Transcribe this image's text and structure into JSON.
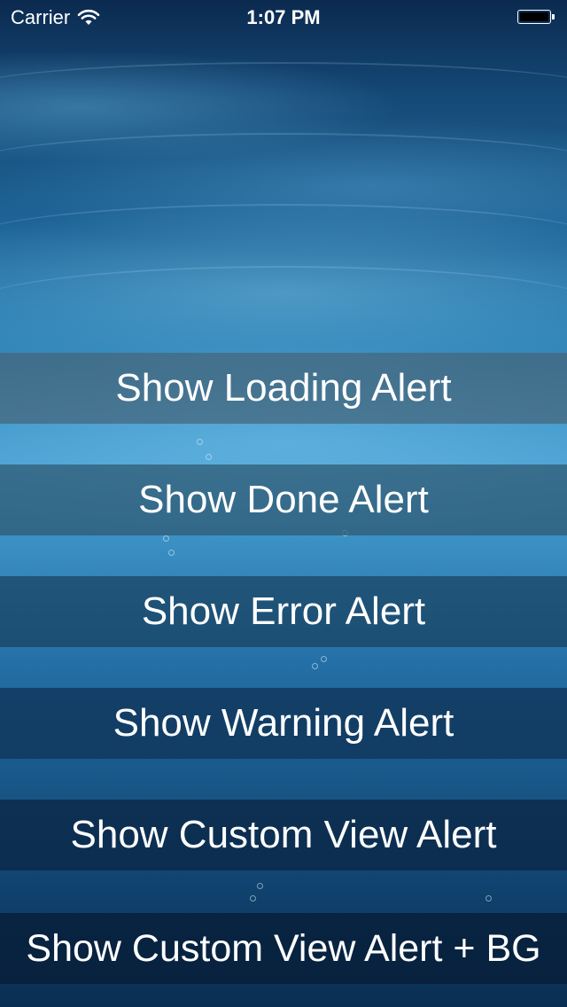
{
  "status_bar": {
    "carrier": "Carrier",
    "time": "1:07 PM",
    "wifi_icon": "wifi-icon",
    "battery_icon": "battery-icon"
  },
  "background": {
    "description_colors": {
      "deep": "#0b2a4f",
      "mid": "#2a7eb2",
      "light": "#4a9fd0"
    }
  },
  "buttons": [
    {
      "label": "Show Loading Alert"
    },
    {
      "label": "Show Done Alert"
    },
    {
      "label": "Show Error Alert"
    },
    {
      "label": "Show Warning Alert"
    },
    {
      "label": "Show Custom View Alert"
    },
    {
      "label": "Show Custom View Alert + BG"
    }
  ]
}
